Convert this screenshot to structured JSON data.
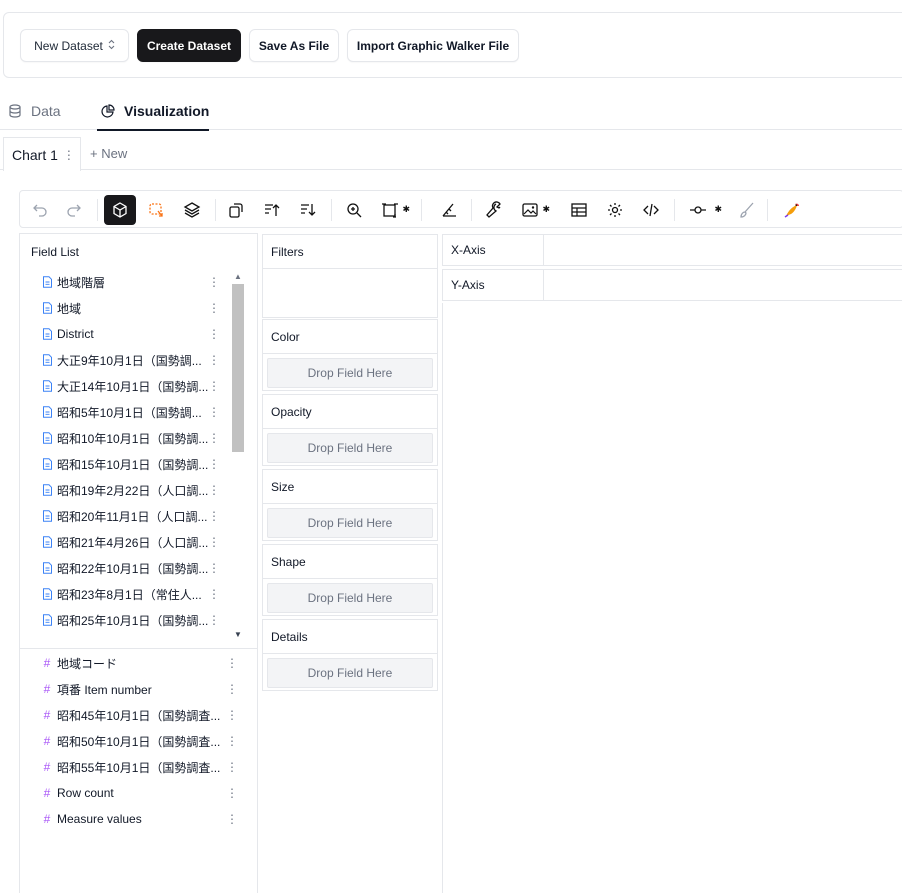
{
  "header": {
    "dataset_select": "New Dataset",
    "create_dataset": "Create Dataset",
    "save_as_file": "Save As File",
    "import_gw_file": "Import Graphic Walker File"
  },
  "tabs": [
    {
      "label": "Data",
      "icon": "database-icon",
      "active": false
    },
    {
      "label": "Visualization",
      "icon": "pie-chart-icon",
      "active": true
    }
  ],
  "chart_tabs": {
    "active": "Chart 1",
    "new": "+ New"
  },
  "toolbar": {
    "icons": [
      "undo-icon",
      "redo-icon",
      "cube-icon",
      "lasso-icon",
      "layers-icon",
      "transpose-icon",
      "sort-ascending-icon",
      "sort-descending-icon",
      "zoom-icon",
      "resize-icon",
      "axis-ruler-icon",
      "wrench-icon",
      "image-icon",
      "table-icon",
      "settings-icon",
      "code-icon",
      "line-node-icon",
      "brush-icon",
      "kanaries-logo-icon"
    ],
    "active": "cube-icon",
    "accent_color": "#f97316"
  },
  "field_list": {
    "title": "Field List",
    "dimensions": [
      "地域階層",
      "地域",
      "District",
      "大正9年10月1日（国勢調...",
      "大正14年10月1日（国勢調...",
      "昭和5年10月1日（国勢調...",
      "昭和10年10月1日（国勢調...",
      "昭和15年10月1日（国勢調...",
      "昭和19年2月22日（人口調...",
      "昭和20年11月1日（人口調...",
      "昭和21年4月26日（人口調...",
      "昭和22年10月1日（国勢調...",
      "昭和23年8月1日（常住人...",
      "昭和25年10月1日（国勢調..."
    ],
    "measures": [
      "地域コード",
      "項番 Item number",
      "昭和45年10月1日（国勢調査...",
      "昭和50年10月1日（国勢調査...",
      "昭和55年10月1日（国勢調査...",
      "Row count",
      "Measure values"
    ],
    "dimension_color": "#3b82f6",
    "measure_color": "#a855f7"
  },
  "encodings": {
    "filters": "Filters",
    "color": "Color",
    "opacity": "Opacity",
    "size": "Size",
    "shape": "Shape",
    "details": "Details",
    "drop_placeholder": "Drop Field Here"
  },
  "axes": {
    "x": "X-Axis",
    "y": "Y-Axis"
  }
}
